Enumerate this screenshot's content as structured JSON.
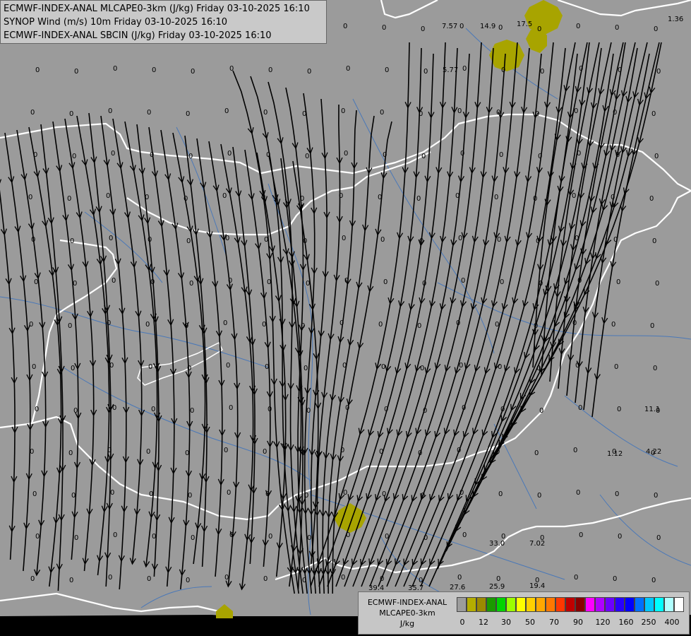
{
  "header": {
    "line1": "ECMWF-INDEX-ANAL MLCAPE0-3km (J/kg) Friday 03-10-2025 16:10",
    "line2": "SYNOP Wind (m/s) 10m Friday 03-10-2025 16:10",
    "line3": "ECMWF-INDEX-ANAL SBCIN (J/kg) Friday 03-10-2025 16:10"
  },
  "legend": {
    "title_line1": "ECMWF-INDEX-ANAL",
    "title_line2": "MLCAPE0-3km",
    "title_line3": "J/kg",
    "colors": [
      "#9c9c9c",
      "#b4ad00",
      "#9b8a00",
      "#1a9a00",
      "#00d400",
      "#9cff00",
      "#ffff00",
      "#ffd000",
      "#ffa800",
      "#ff7800",
      "#ff3800",
      "#c00000",
      "#8a0000",
      "#ff00ff",
      "#b000ff",
      "#6c00ff",
      "#2800ff",
      "#0000ff",
      "#0070ff",
      "#00c8ff",
      "#00ffff",
      "#b0ffff",
      "#ffffff"
    ],
    "ticks": [
      "0",
      "12",
      "30",
      "50",
      "70",
      "90",
      "120",
      "160",
      "250",
      "400"
    ]
  },
  "colors": {
    "background": "#9b9b9b",
    "river": "#4a78b8",
    "border": "#ffffff",
    "cape_marker": "#a8a400"
  },
  "stations": [
    {
      "label": "7.57"
    },
    {
      "label": "14.9"
    },
    {
      "label": "17.5"
    },
    {
      "label": "1.36"
    },
    {
      "label": "5.77"
    },
    {
      "label": "11.1"
    },
    {
      "label": "1.12"
    },
    {
      "label": "4.22"
    },
    {
      "label": "7.02"
    },
    {
      "label": "33.0"
    },
    {
      "label": "39.4"
    },
    {
      "label": "35.7"
    },
    {
      "label": "27.6"
    },
    {
      "label": "25.9"
    },
    {
      "label": "19.4"
    }
  ],
  "zero_label": "0"
}
